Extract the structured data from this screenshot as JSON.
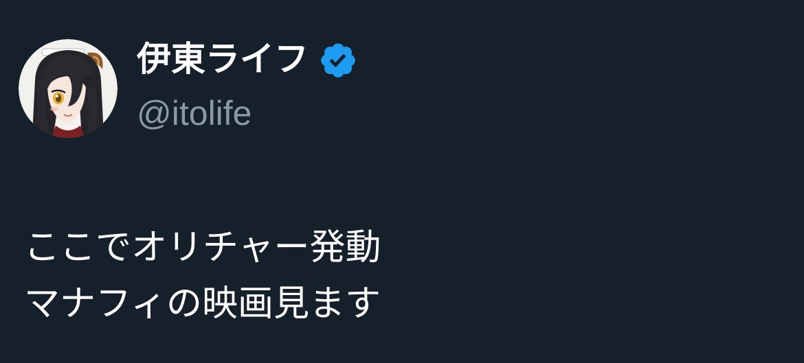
{
  "author": {
    "display_name": "伊東ライフ",
    "handle": "@itolife",
    "verified": true,
    "avatar_icon": "avatar-icon",
    "verified_icon": "verified-badge-icon"
  },
  "tweet": {
    "lines": [
      "ここでオリチャー発動",
      "マナフィの映画見ます"
    ]
  },
  "colors": {
    "background": "#16202b",
    "name": "#ffffff",
    "handle": "#8b98a5",
    "text": "#ffffff",
    "verified": "#1d9bf0"
  }
}
